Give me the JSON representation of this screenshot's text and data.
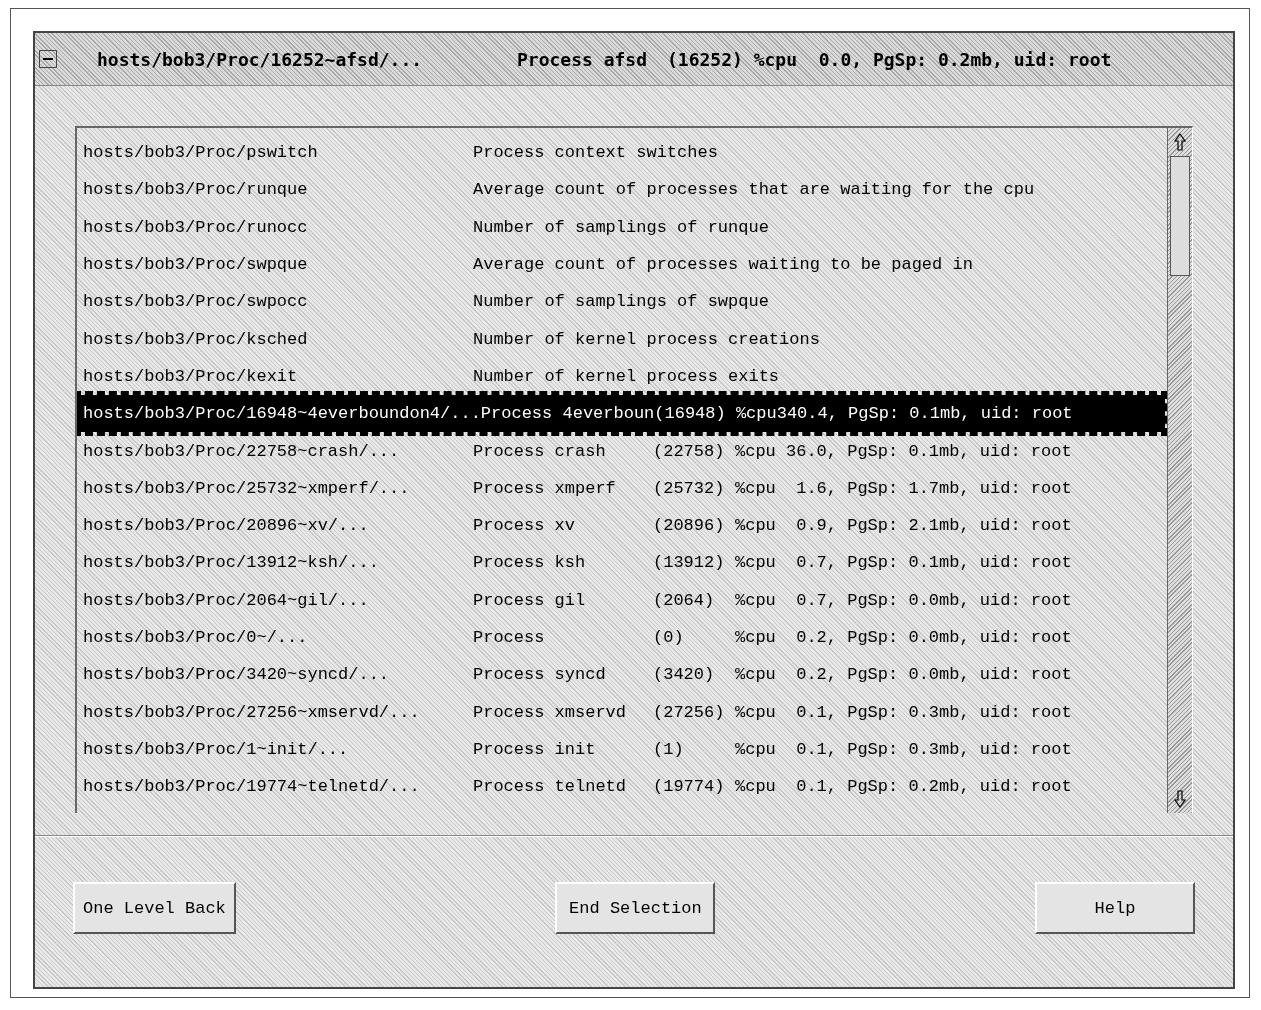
{
  "window": {
    "title": {
      "path": "hosts/bob3/Proc/16252~afsd/...",
      "process": "Process afsd",
      "stats": "(16252) %cpu  0.0, PgSp: 0.2mb, uid: root"
    }
  },
  "list": {
    "rows": [
      {
        "kind": "metric",
        "selected": false,
        "path": "hosts/bob3/Proc/pswitch",
        "description": "Process context switches"
      },
      {
        "kind": "metric",
        "selected": false,
        "path": "hosts/bob3/Proc/runque",
        "description": "Average count of processes that are waiting for the cpu"
      },
      {
        "kind": "metric",
        "selected": false,
        "path": "hosts/bob3/Proc/runocc",
        "description": "Number of samplings of runque"
      },
      {
        "kind": "metric",
        "selected": false,
        "path": "hosts/bob3/Proc/swpque",
        "description": "Average count of processes waiting to be paged in"
      },
      {
        "kind": "metric",
        "selected": false,
        "path": "hosts/bob3/Proc/swpocc",
        "description": "Number of samplings of swpque"
      },
      {
        "kind": "metric",
        "selected": false,
        "path": "hosts/bob3/Proc/ksched",
        "description": "Number of kernel process creations"
      },
      {
        "kind": "metric",
        "selected": false,
        "path": "hosts/bob3/Proc/kexit",
        "description": "Number of kernel process exits"
      },
      {
        "kind": "line",
        "selected": true,
        "text": "hosts/bob3/Proc/16948~4everboundon4/...Process 4everboun(16948) %cpu340.4, PgSp: 0.1mb, uid: root"
      },
      {
        "kind": "process",
        "selected": false,
        "path": "hosts/bob3/Proc/22758~crash/...",
        "process": "Process crash",
        "pid": "(22758)",
        "stats": "%cpu 36.0, PgSp: 0.1mb, uid: root"
      },
      {
        "kind": "process",
        "selected": false,
        "path": "hosts/bob3/Proc/25732~xmperf/...",
        "process": "Process xmperf",
        "pid": "(25732)",
        "stats": "%cpu  1.6, PgSp: 1.7mb, uid: root"
      },
      {
        "kind": "process",
        "selected": false,
        "path": "hosts/bob3/Proc/20896~xv/...",
        "process": "Process xv",
        "pid": "(20896)",
        "stats": "%cpu  0.9, PgSp: 2.1mb, uid: root"
      },
      {
        "kind": "process",
        "selected": false,
        "path": "hosts/bob3/Proc/13912~ksh/...",
        "process": "Process ksh",
        "pid": "(13912)",
        "stats": "%cpu  0.7, PgSp: 0.1mb, uid: root"
      },
      {
        "kind": "process",
        "selected": false,
        "path": "hosts/bob3/Proc/2064~gil/...",
        "process": "Process gil",
        "pid": "(2064)",
        "stats": "%cpu  0.7, PgSp: 0.0mb, uid: root"
      },
      {
        "kind": "process",
        "selected": false,
        "path": "hosts/bob3/Proc/0~/...",
        "process": "Process",
        "pid": "(0)",
        "stats": "%cpu  0.2, PgSp: 0.0mb, uid: root"
      },
      {
        "kind": "process",
        "selected": false,
        "path": "hosts/bob3/Proc/3420~syncd/...",
        "process": "Process syncd",
        "pid": "(3420)",
        "stats": "%cpu  0.2, PgSp: 0.0mb, uid: root"
      },
      {
        "kind": "process",
        "selected": false,
        "path": "hosts/bob3/Proc/27256~xmservd/...",
        "process": "Process xmservd",
        "pid": "(27256)",
        "stats": "%cpu  0.1, PgSp: 0.3mb, uid: root"
      },
      {
        "kind": "process",
        "selected": false,
        "path": "hosts/bob3/Proc/1~init/...",
        "process": "Process init",
        "pid": "(1)",
        "stats": "%cpu  0.1, PgSp: 0.3mb, uid: root"
      },
      {
        "kind": "process",
        "selected": false,
        "path": "hosts/bob3/Proc/19774~telnetd/...",
        "process": "Process telnetd",
        "pid": "(19774)",
        "stats": "%cpu  0.1, PgSp: 0.2mb, uid: root"
      }
    ]
  },
  "buttons": [
    "One Level Back",
    "End Selection",
    "Help"
  ]
}
